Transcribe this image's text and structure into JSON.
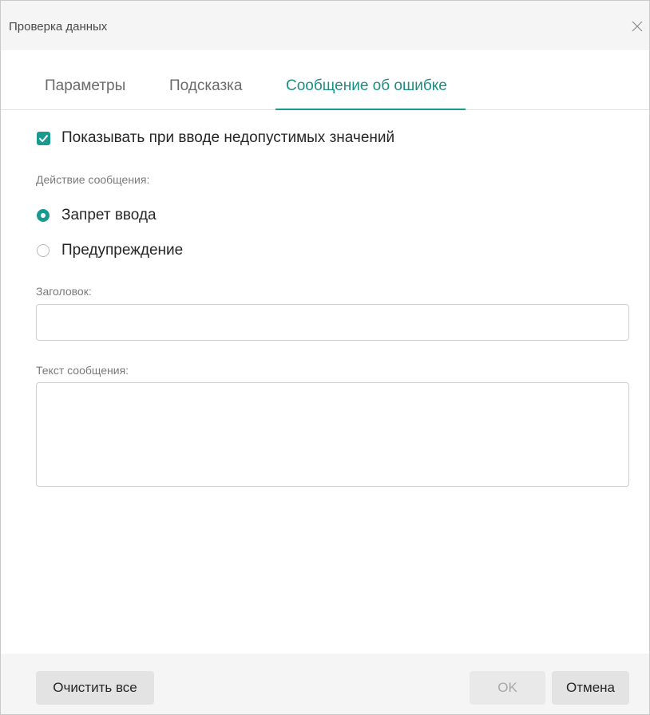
{
  "dialog": {
    "title": "Проверка данных"
  },
  "tabs": [
    {
      "label": "Параметры",
      "active": false
    },
    {
      "label": "Подсказка",
      "active": false
    },
    {
      "label": "Сообщение об ошибке",
      "active": true
    }
  ],
  "show_on_invalid": {
    "label": "Показывать при вводе недопустимых значений",
    "checked": true
  },
  "action": {
    "label": "Действие сообщения:",
    "options": [
      {
        "label": "Запрет ввода",
        "selected": true
      },
      {
        "label": "Предупреждение",
        "selected": false
      }
    ]
  },
  "heading_field": {
    "label": "Заголовок:",
    "value": ""
  },
  "message_field": {
    "label": "Текст сообщения:",
    "value": ""
  },
  "buttons": {
    "clear_all": "Очистить все",
    "ok": "OK",
    "cancel": "Отмена"
  },
  "colors": {
    "accent": "#1a9a8f",
    "footer_bg": "#f5f5f5"
  }
}
